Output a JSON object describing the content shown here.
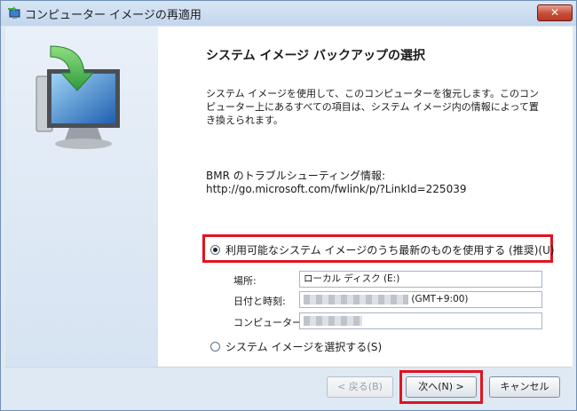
{
  "window": {
    "title": "コンピューター イメージの再適用",
    "close_label": "✕"
  },
  "page": {
    "heading": "システム イメージ バックアップの選択",
    "description": "システム イメージを使用して、このコンピューターを復元します。このコンピューター上にあるすべての項目は、システム イメージ内の情報によって置き換えられます。",
    "bmr_label": "BMR のトラブルシューティング情報:",
    "bmr_url": "http://go.microsoft.com/fwlink/p/?LinkId=225039"
  },
  "options": {
    "latest_label": "利用可能なシステム イメージのうち最新のものを使用する (推奨)(U)",
    "latest_selected": true,
    "select_label": "システム イメージを選択する(S)",
    "select_selected": false
  },
  "details": {
    "location_label": "場所:",
    "location_value": "ローカル ディスク (E:)",
    "datetime_label": "日付と時刻:",
    "datetime_value": "(GMT+9:00)",
    "computer_label": "コンピューター:"
  },
  "buttons": {
    "back_label": "< 戻る(B)",
    "next_label": "次へ(N) >",
    "cancel_label": "キャンセル"
  },
  "colors": {
    "highlight": "#e0141e",
    "side_panel": "#d6e3f2"
  }
}
